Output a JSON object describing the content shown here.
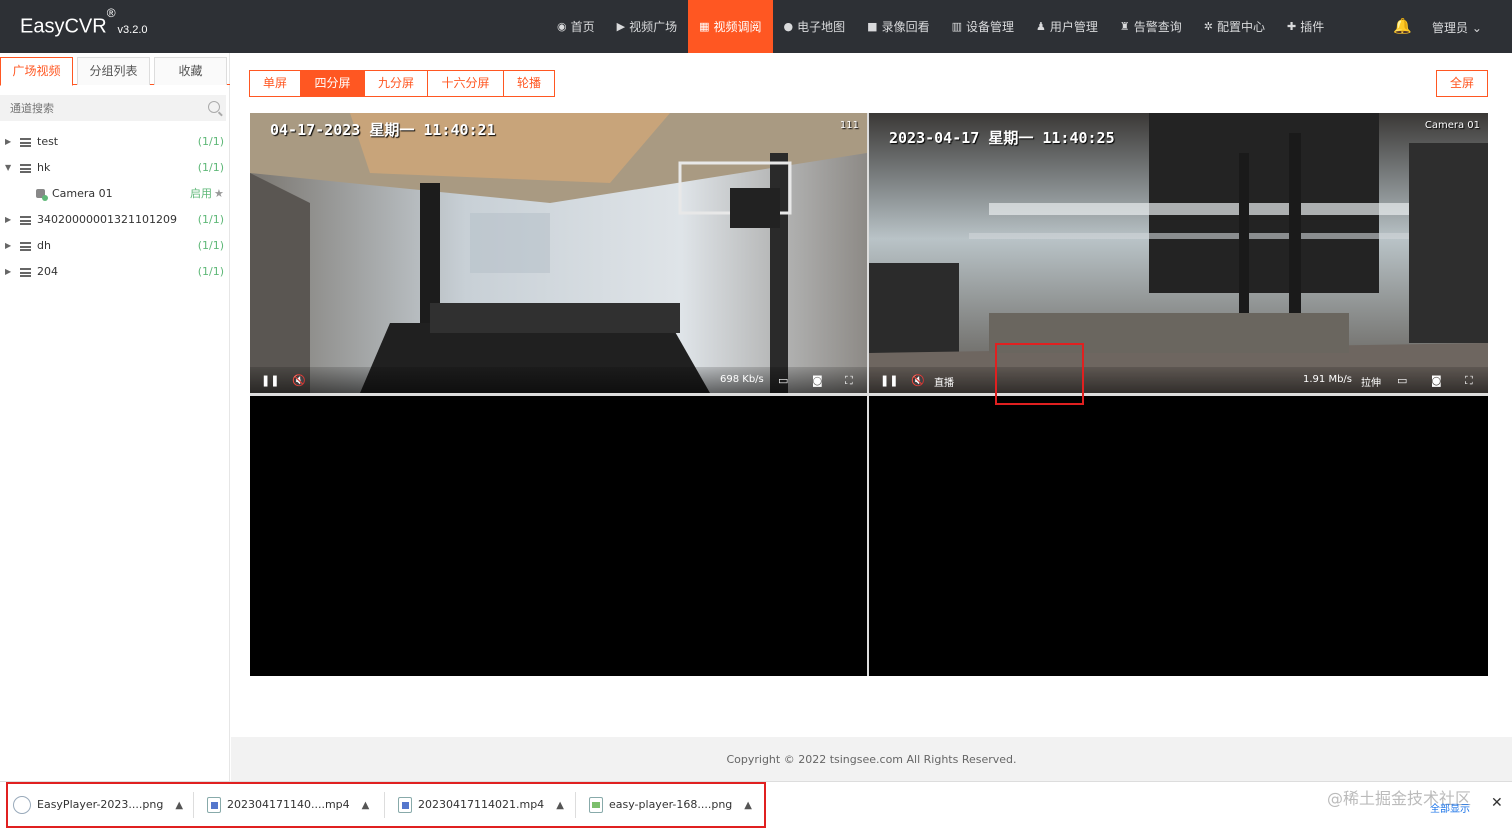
{
  "app": {
    "name": "EasyCVR",
    "reg": "®",
    "version": "v3.2.0"
  },
  "nav": {
    "items": [
      {
        "label": "首页",
        "icon": "dashboard-icon",
        "glyph": "◉"
      },
      {
        "label": "视频广场",
        "icon": "play-circle-icon",
        "glyph": "▶"
      },
      {
        "label": "视频调阅",
        "icon": "video-grid-icon",
        "glyph": "▦",
        "active": true
      },
      {
        "label": "电子地图",
        "icon": "map-pin-icon",
        "glyph": "●"
      },
      {
        "label": "录像回看",
        "icon": "video-camera-icon",
        "glyph": "■"
      },
      {
        "label": "设备管理",
        "icon": "device-icon",
        "glyph": "▥"
      },
      {
        "label": "用户管理",
        "icon": "user-icon",
        "glyph": "♟"
      },
      {
        "label": "告警查询",
        "icon": "alarm-icon",
        "glyph": "♜"
      },
      {
        "label": "配置中心",
        "icon": "gear-icon",
        "glyph": "✲"
      },
      {
        "label": "插件",
        "icon": "puzzle-icon",
        "glyph": "✚"
      }
    ],
    "bell_glyph": "🔔",
    "user": "管理员",
    "user_caret": "⌄"
  },
  "sidebar": {
    "tabs": [
      "广场视频",
      "分组列表",
      "收藏"
    ],
    "search_placeholder": "通道搜索",
    "tree": [
      {
        "label": "test",
        "count": "(1/1)",
        "expanded": false
      },
      {
        "label": "hk",
        "count": "(1/1)",
        "expanded": true
      },
      {
        "label": "Camera 01",
        "status": "启用",
        "is_camera": true
      },
      {
        "label": "34020000001321101209",
        "count": "(1/1)",
        "expanded": false
      },
      {
        "label": "dh",
        "count": "(1/1)",
        "expanded": false
      },
      {
        "label": "204",
        "count": "(1/1)",
        "expanded": false
      }
    ]
  },
  "toolbar": {
    "splits": [
      "单屏",
      "四分屏",
      "九分屏",
      "十六分屏",
      "轮播"
    ],
    "active_split": "四分屏",
    "fullscreen": "全屏"
  },
  "panes": [
    {
      "osd": "04-17-2023  星期一  11:40:21",
      "corner": "111",
      "bitrate": "698 Kb/s"
    },
    {
      "osd": "2023-04-17  星期一  11:40:25",
      "corner": "Camera 01",
      "live": "直播",
      "bitrate": "1.91 Mb/s",
      "stretch": "拉伸"
    }
  ],
  "footer": {
    "copyright": "Copyright © 2022 tsingsee.com All Rights Reserved."
  },
  "downloads": {
    "items": [
      {
        "name": "EasyPlayer-2023....png",
        "type": "img"
      },
      {
        "name": "2023041711​40....mp4",
        "type": "vid"
      },
      {
        "name": "20230417114021.mp4",
        "type": "vid"
      },
      {
        "name": "easy-player-168....png",
        "type": "img"
      }
    ],
    "show_all": "全部显示",
    "close": "✕"
  },
  "watermark": "@稀土掘金技术社区",
  "colors": {
    "accent": "#ff5722",
    "navbar": "#2d3035",
    "ok": "#5fb878",
    "highlight": "#e02020"
  }
}
